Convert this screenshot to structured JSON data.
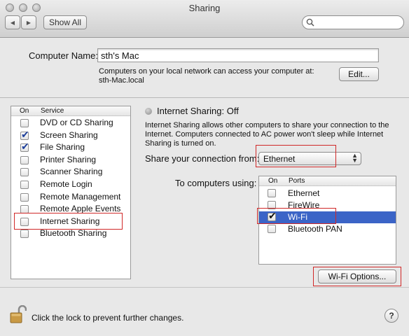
{
  "window": {
    "title": "Sharing"
  },
  "toolbar": {
    "show_all": "Show All",
    "back": "◀",
    "forward": "▶"
  },
  "search": {
    "placeholder": ""
  },
  "computer_name": {
    "label": "Computer Name:",
    "value": "sth's Mac",
    "description_line1": "Computers on your local network can access your computer at:",
    "description_line2": "sth-Mac.local",
    "edit_button": "Edit..."
  },
  "service_list": {
    "header_on": "On",
    "header_service": "Service",
    "items": [
      {
        "label": "DVD or CD Sharing",
        "checked": false
      },
      {
        "label": "Screen Sharing",
        "checked": true
      },
      {
        "label": "File Sharing",
        "checked": true
      },
      {
        "label": "Printer Sharing",
        "checked": false
      },
      {
        "label": "Scanner Sharing",
        "checked": false
      },
      {
        "label": "Remote Login",
        "checked": false
      },
      {
        "label": "Remote Management",
        "checked": false
      },
      {
        "label": "Remote Apple Events",
        "checked": false
      },
      {
        "label": "Internet Sharing",
        "checked": false
      },
      {
        "label": "Bluetooth Sharing",
        "checked": false
      }
    ]
  },
  "detail": {
    "status": "Internet Sharing: Off",
    "description": "Internet Sharing allows other computers to share your connection to the Internet. Computers connected to AC power won't sleep while Internet Sharing is turned on.",
    "share_from_label": "Share your connection from:",
    "share_from_value": "Ethernet",
    "to_computers_label": "To computers using:",
    "ports_header_on": "On",
    "ports_header_ports": "Ports",
    "ports": [
      {
        "label": "Ethernet",
        "checked": false
      },
      {
        "label": "FireWire",
        "checked": false
      },
      {
        "label": "Wi-Fi",
        "checked": true
      },
      {
        "label": "Bluetooth PAN",
        "checked": false
      }
    ],
    "wifi_options_button": "Wi-Fi Options..."
  },
  "footer": {
    "lock_text": "Click the lock to prevent further changes.",
    "help": "?"
  },
  "colors": {
    "highlight_box": "#d02828",
    "checkmark": "#1c3e9a"
  }
}
